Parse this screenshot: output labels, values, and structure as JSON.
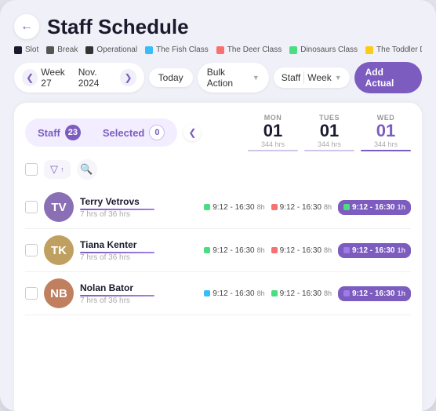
{
  "page": {
    "title": "Staff Schedule",
    "back_label": "←"
  },
  "legend": [
    {
      "label": "Slot",
      "color": "#1a1a2e"
    },
    {
      "label": "Break",
      "color": "#555"
    },
    {
      "label": "Operational",
      "color": "#333"
    },
    {
      "label": "The Fish Class",
      "color": "#38bdf8"
    },
    {
      "label": "The Deer Class",
      "color": "#f87171"
    },
    {
      "label": "Dinosaurs Class",
      "color": "#4ade80"
    },
    {
      "label": "The Toddler Daycare Class",
      "color": "#facc15"
    }
  ],
  "toolbar": {
    "week_label": "Week 27",
    "month_label": "Nov. 2024",
    "today_label": "Today",
    "bulk_label": "Bulk Action",
    "staff_label": "Staff",
    "week_dropdown": "Week",
    "add_actual_label": "Add Actual"
  },
  "staff_tabs": {
    "staff_label": "Staff",
    "staff_count": "23",
    "selected_label": "Selected",
    "selected_count": "0"
  },
  "calendar": {
    "arrow_left": "❮",
    "days": [
      {
        "label": "MON",
        "num": "01",
        "hrs": "344 hrs",
        "color": "#d1c4e9",
        "active": false
      },
      {
        "label": "TUES",
        "num": "01",
        "hrs": "344 hrs",
        "color": "#d1c4e9",
        "active": false
      },
      {
        "label": "WED",
        "num": "01",
        "hrs": "344 hrs",
        "color": "#7c5cbf",
        "active": true
      }
    ]
  },
  "staff_rows": [
    {
      "name": "Terry Vetrovs",
      "hrs": "7 hrs of 36 hrs",
      "avatar_initials": "TV",
      "avatar_bg": "#8b6fb5",
      "shifts": [
        {
          "time": "9:12 - 16:30",
          "hrs": "8h",
          "dot_color": "#4ade80",
          "active": false
        },
        {
          "time": "9:12 - 16:30",
          "hrs": "8h",
          "dot_color": "#f87171",
          "active": false
        },
        {
          "time": "9:12 - 16:30",
          "hrs": "1h",
          "dot_color": "#4ade80",
          "active": true
        }
      ]
    },
    {
      "name": "Tiana Kenter",
      "hrs": "7 hrs of 36 hrs",
      "avatar_initials": "TK",
      "avatar_bg": "#c0a060",
      "shifts": [
        {
          "time": "9:12 - 16:30",
          "hrs": "8h",
          "dot_color": "#4ade80",
          "active": false
        },
        {
          "time": "9:12 - 16:30",
          "hrs": "8h",
          "dot_color": "#f87171",
          "active": false
        },
        {
          "time": "9:12 - 16:30",
          "hrs": "1h",
          "dot_color": "#9b7ce8",
          "active": true
        }
      ]
    },
    {
      "name": "Nolan Bator",
      "hrs": "7 hrs of 36 hrs",
      "avatar_initials": "NB",
      "avatar_bg": "#c08060",
      "shifts": [
        {
          "time": "9:12 - 16:30",
          "hrs": "8h",
          "dot_color": "#38bdf8",
          "active": false
        },
        {
          "time": "9:12 - 16:30",
          "hrs": "8h",
          "dot_color": "#4ade80",
          "active": false
        },
        {
          "time": "9:12 - 16:30",
          "hrs": "1h",
          "dot_color": "#9b7ce8",
          "active": true
        }
      ]
    }
  ],
  "controls": {
    "filter_icon": "⊿",
    "search_icon": "🔍"
  }
}
